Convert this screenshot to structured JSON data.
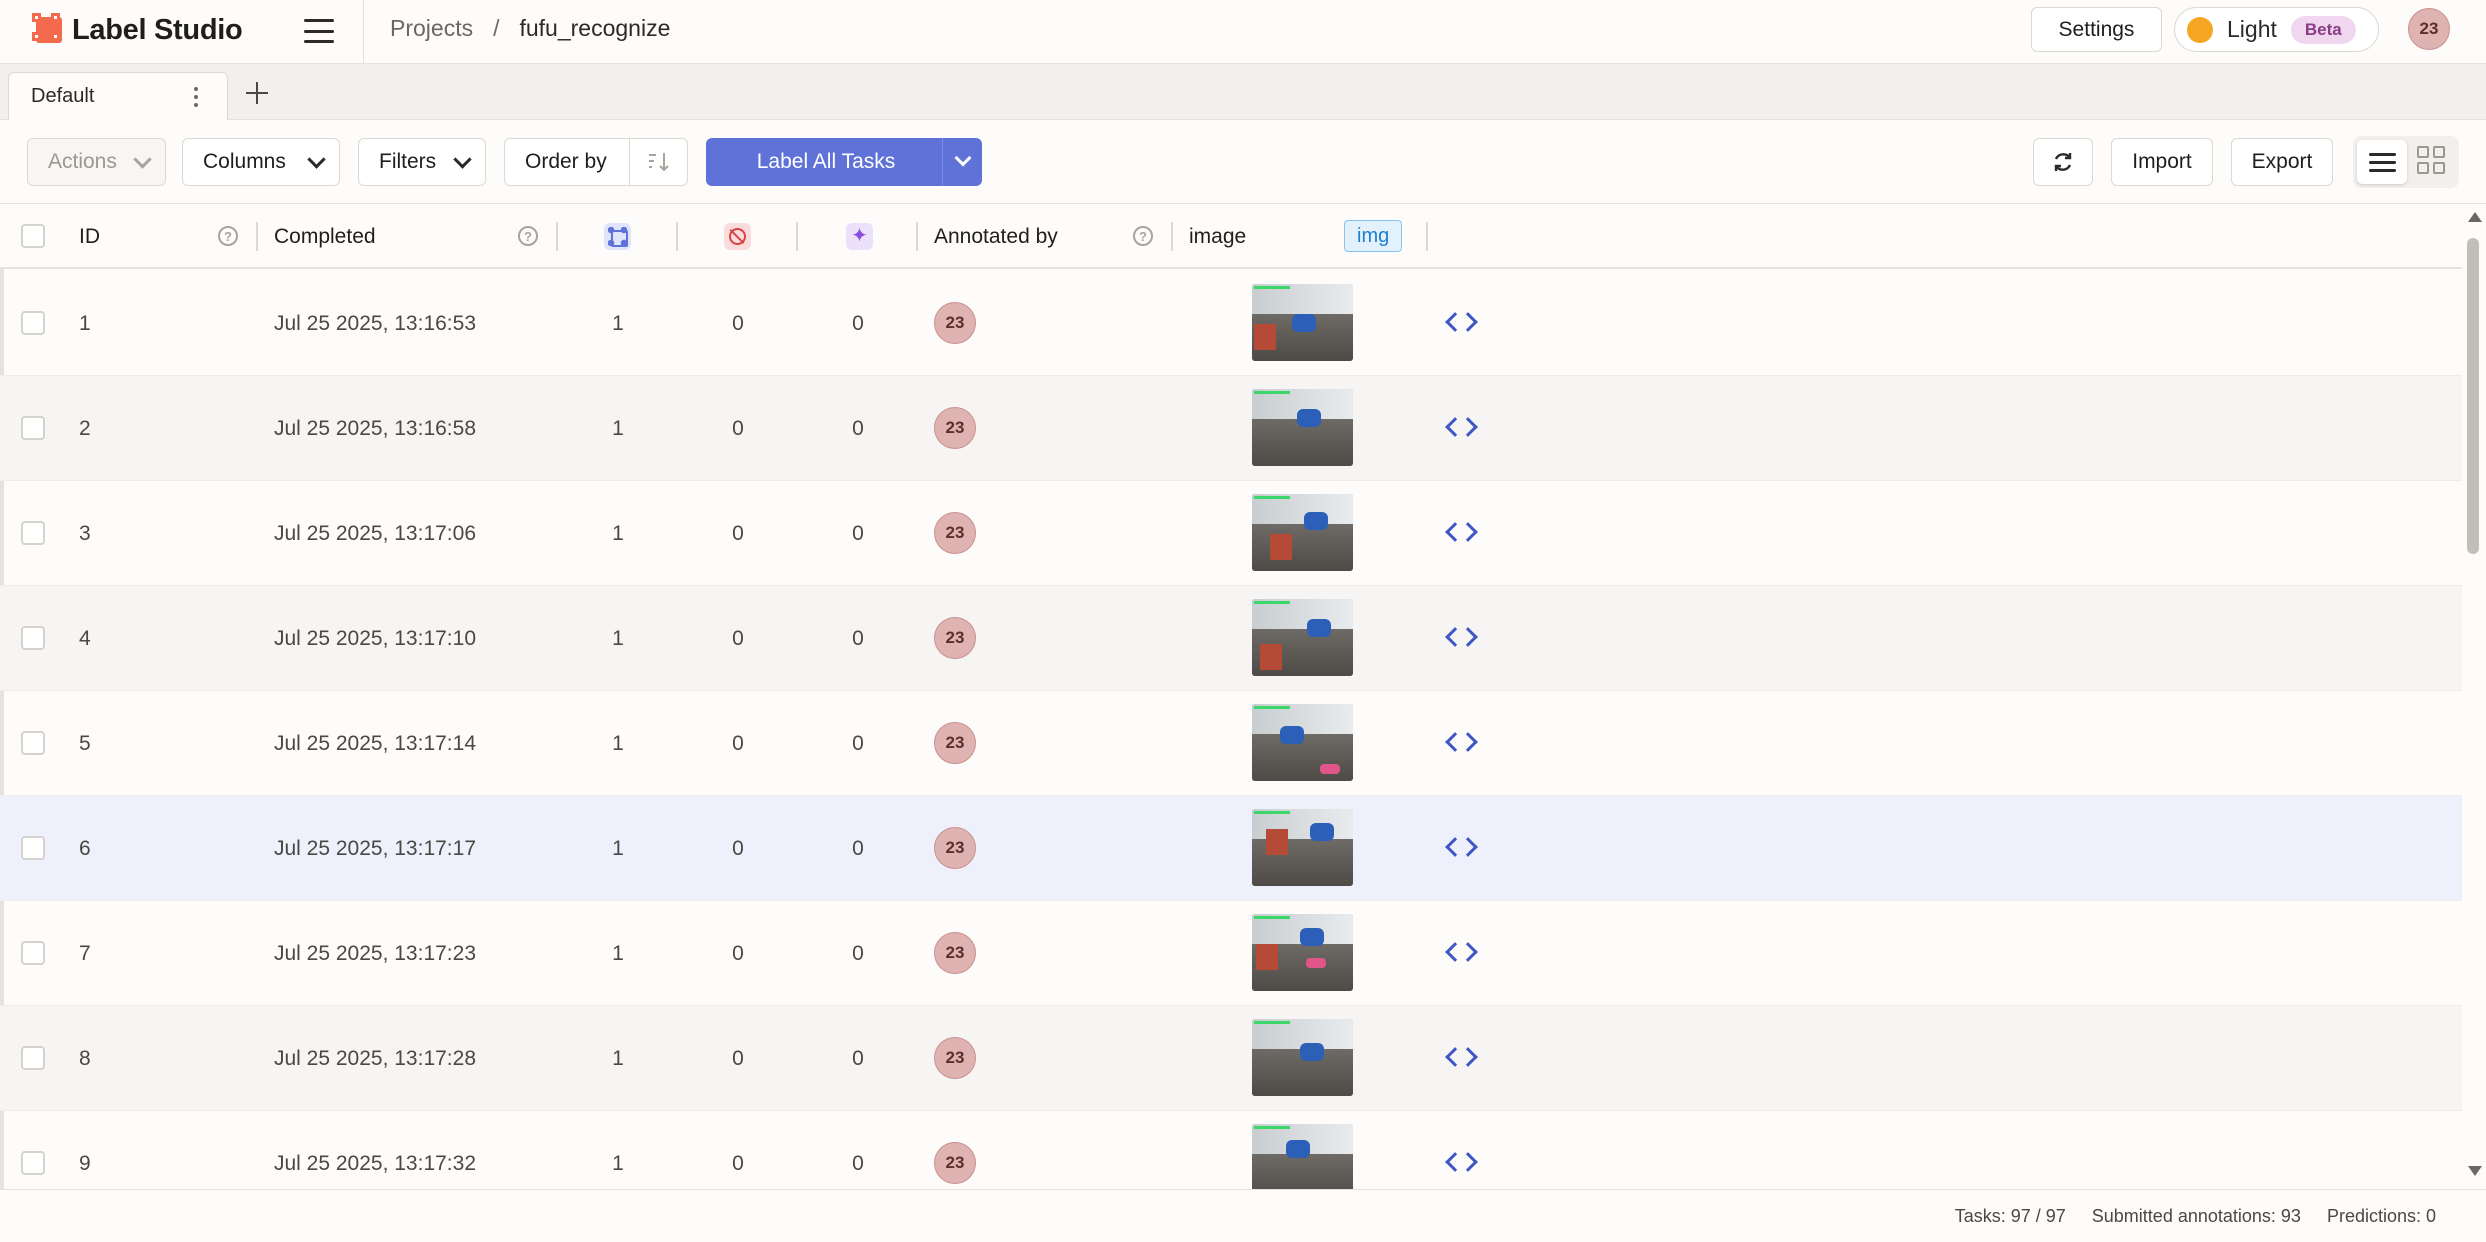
{
  "app": {
    "name": "Label Studio"
  },
  "breadcrumb": {
    "projects": "Projects",
    "separator": "/",
    "current": "fufu_recognize"
  },
  "header": {
    "settings_label": "Settings",
    "theme_label": "Light",
    "theme_badge": "Beta",
    "user_initials": "23"
  },
  "tabs": [
    {
      "label": "Default"
    }
  ],
  "toolbar": {
    "actions_label": "Actions",
    "columns_label": "Columns",
    "filters_label": "Filters",
    "order_by_label": "Order by",
    "label_all_label": "Label All Tasks",
    "import_label": "Import",
    "export_label": "Export"
  },
  "table": {
    "columns": {
      "id": "ID",
      "completed": "Completed",
      "annotated_by": "Annotated by",
      "image": "image",
      "image_badge": "img"
    },
    "rows": [
      {
        "id": "1",
        "completed": "Jul 25 2025, 13:16:53",
        "annotations": "1",
        "cancelled": "0",
        "predictions": "0",
        "annotator": "23"
      },
      {
        "id": "2",
        "completed": "Jul 25 2025, 13:16:58",
        "annotations": "1",
        "cancelled": "0",
        "predictions": "0",
        "annotator": "23"
      },
      {
        "id": "3",
        "completed": "Jul 25 2025, 13:17:06",
        "annotations": "1",
        "cancelled": "0",
        "predictions": "0",
        "annotator": "23"
      },
      {
        "id": "4",
        "completed": "Jul 25 2025, 13:17:10",
        "annotations": "1",
        "cancelled": "0",
        "predictions": "0",
        "annotator": "23"
      },
      {
        "id": "5",
        "completed": "Jul 25 2025, 13:17:14",
        "annotations": "1",
        "cancelled": "0",
        "predictions": "0",
        "annotator": "23"
      },
      {
        "id": "6",
        "completed": "Jul 25 2025, 13:17:17",
        "annotations": "1",
        "cancelled": "0",
        "predictions": "0",
        "annotator": "23"
      },
      {
        "id": "7",
        "completed": "Jul 25 2025, 13:17:23",
        "annotations": "1",
        "cancelled": "0",
        "predictions": "0",
        "annotator": "23"
      },
      {
        "id": "8",
        "completed": "Jul 25 2025, 13:17:28",
        "annotations": "1",
        "cancelled": "0",
        "predictions": "0",
        "annotator": "23"
      },
      {
        "id": "9",
        "completed": "Jul 25 2025, 13:17:32",
        "annotations": "1",
        "cancelled": "0",
        "predictions": "0",
        "annotator": "23"
      }
    ]
  },
  "footer": {
    "tasks": "Tasks: 97 / 97",
    "submitted": "Submitted annotations: 93",
    "predictions": "Predictions: 0"
  },
  "colors": {
    "accent": "#5f72d8",
    "logo": "#f46a4c",
    "theme_dot": "#f5a623",
    "avatar_bg": "#dfb3b1"
  }
}
